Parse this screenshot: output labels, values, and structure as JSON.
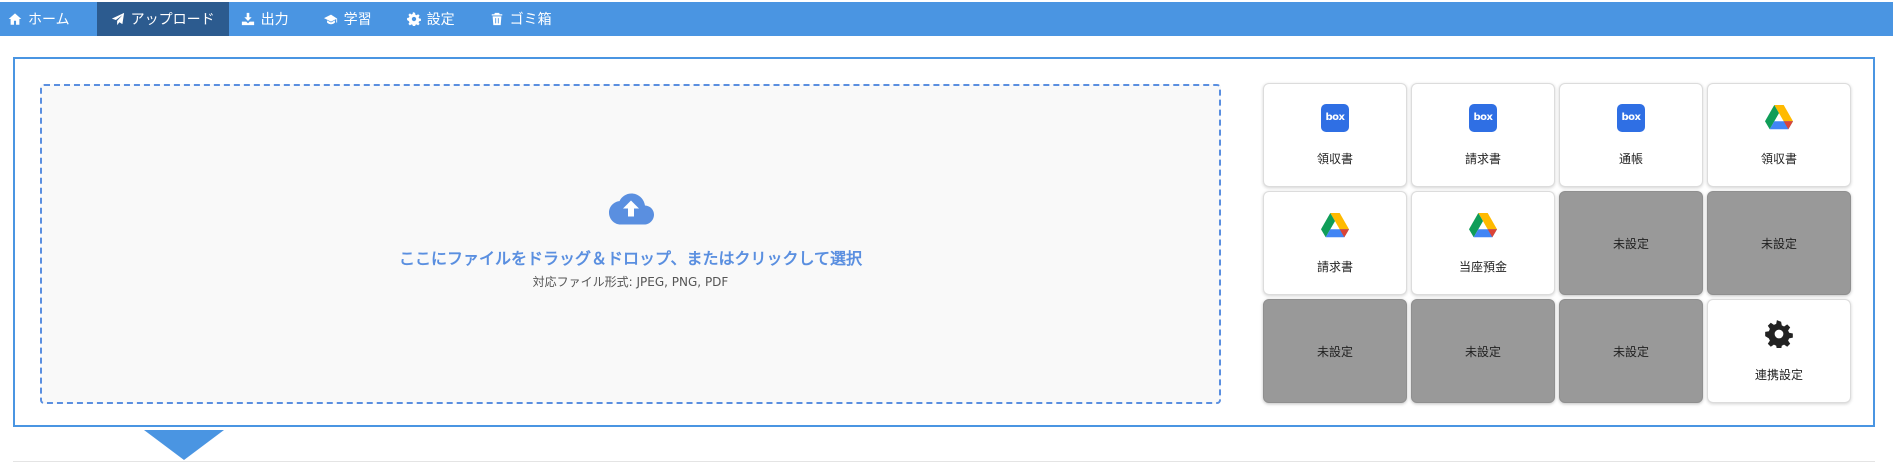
{
  "nav": {
    "items": [
      {
        "label": "ホーム",
        "icon": "home-icon"
      },
      {
        "label": "アップロード",
        "icon": "send-icon"
      },
      {
        "label": "出力",
        "icon": "download-icon"
      },
      {
        "label": "学習",
        "icon": "graduation-cap-icon"
      },
      {
        "label": "設定",
        "icon": "gear-icon"
      },
      {
        "label": "ゴミ箱",
        "icon": "trash-icon"
      }
    ],
    "active_index": 1
  },
  "dropzone": {
    "main_text": "ここにファイルをドラッグ＆ドロップ、またはクリックして選択",
    "sub_text": "対応ファイル形式: JPEG, PNG, PDF",
    "icon": "cloud-upload-icon"
  },
  "tiles": [
    {
      "label": "領収書",
      "icon": "box-icon",
      "box_text": "box",
      "state": "set"
    },
    {
      "label": "請求書",
      "icon": "box-icon",
      "box_text": "box",
      "state": "set"
    },
    {
      "label": "通帳",
      "icon": "box-icon",
      "box_text": "box",
      "state": "set"
    },
    {
      "label": "領収書",
      "icon": "google-drive-icon",
      "state": "set"
    },
    {
      "label": "請求書",
      "icon": "google-drive-icon",
      "state": "set"
    },
    {
      "label": "当座預金",
      "icon": "google-drive-icon",
      "state": "set"
    },
    {
      "label": "未設定",
      "state": "unset"
    },
    {
      "label": "未設定",
      "state": "unset"
    },
    {
      "label": "未設定",
      "state": "unset"
    },
    {
      "label": "未設定",
      "state": "unset"
    },
    {
      "label": "未設定",
      "state": "unset"
    },
    {
      "label": "連携設定",
      "icon": "gear-icon",
      "state": "set"
    }
  ],
  "colors": {
    "nav_bg": "#4a95e2",
    "nav_active_bg": "#2c5b8f",
    "accent": "#5a8fe0",
    "box_blue": "#2f6fe4",
    "unset_tile": "#999999"
  }
}
